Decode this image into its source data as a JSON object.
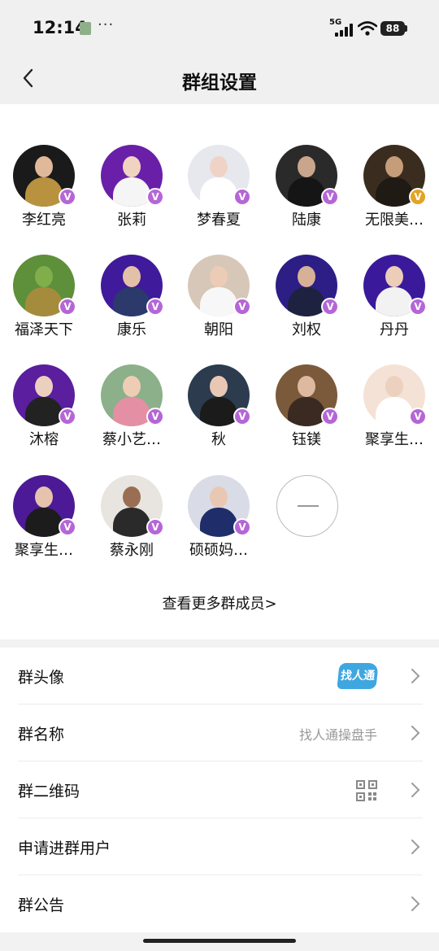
{
  "status_bar": {
    "time": "12:14",
    "dots": "···",
    "network": "5G",
    "battery": "88"
  },
  "header": {
    "title": "群组设置"
  },
  "members": [
    {
      "name": "李红亮",
      "bg": "#1a1a1a",
      "body": "#b8923e",
      "head": "#e0b89a",
      "badge": "#b566d6"
    },
    {
      "name": "张莉",
      "bg": "#6a1fa8",
      "body": "#f5f5f5",
      "head": "#f0d3c0",
      "badge": "#b566d6"
    },
    {
      "name": "梦春夏",
      "bg": "#e6e8ee",
      "body": "#ffffff",
      "head": "#efd3c6",
      "badge": "#b566d6"
    },
    {
      "name": "陆康",
      "bg": "#2a2a2a",
      "body": "#151515",
      "head": "#c9a58b",
      "badge": "#b566d6"
    },
    {
      "name": "无限美…",
      "bg": "#3a2d1f",
      "body": "#1f1a14",
      "head": "#c59d7a",
      "badge": "#e3a326"
    },
    {
      "name": "福泽天下",
      "bg": "#5e8f3a",
      "body": "#a58c3c",
      "head": "#7fae4a",
      "badge": "#b566d6"
    },
    {
      "name": "康乐",
      "bg": "#3f1a9a",
      "body": "#2b3a6a",
      "head": "#e3c1a8",
      "badge": "#b566d6"
    },
    {
      "name": "朝阳",
      "bg": "#d7c7b8",
      "body": "#f7f7f7",
      "head": "#ecccb6",
      "badge": "#b566d6"
    },
    {
      "name": "刘权",
      "bg": "#2d1e86",
      "body": "#1d2240",
      "head": "#d6b196",
      "badge": "#b566d6"
    },
    {
      "name": "丹丹",
      "bg": "#3a1a9a",
      "body": "#f2f2f2",
      "head": "#eccdb8",
      "badge": "#b566d6"
    },
    {
      "name": "沐榕",
      "bg": "#5a1e9e",
      "body": "#222222",
      "head": "#ecd0bf",
      "badge": "#b566d6"
    },
    {
      "name": "蔡小艺…",
      "bg": "#8bb08a",
      "body": "#e58fa4",
      "head": "#eecdb5",
      "badge": "#b566d6"
    },
    {
      "name": "秋",
      "bg": "#2c3b4e",
      "body": "#1b1b1b",
      "head": "#e8c8b4",
      "badge": "#b566d6"
    },
    {
      "name": "钰镁",
      "bg": "#7a5a3a",
      "body": "#3a2a22",
      "head": "#ddb9a0",
      "badge": "#b566d6"
    },
    {
      "name": "聚享生…",
      "bg": "#f4e2d6",
      "body": "#ffffff",
      "head": "#edd1bf",
      "badge": "#b566d6"
    },
    {
      "name": "聚享生…",
      "bg": "#4c1a96",
      "body": "#1c1c1c",
      "head": "#e6c3ad",
      "badge": "#b566d6"
    },
    {
      "name": "蔡永刚",
      "bg": "#e8e4e0",
      "body": "#2a2a2a",
      "head": "#9a6e52",
      "badge": "#b566d6"
    },
    {
      "name": "硕硕妈…",
      "bg": "#d9dce6",
      "body": "#1f2e6a",
      "head": "#e9c8b3",
      "badge": "#b566d6"
    }
  ],
  "badge_letter": "V",
  "view_more_label": "查看更多群成员>",
  "settings": {
    "avatar": {
      "label": "群头像",
      "logo_text": "找人通"
    },
    "name": {
      "label": "群名称",
      "value": "找人通操盘手"
    },
    "qr": {
      "label": "群二维码"
    },
    "requests": {
      "label": "申请进群用户"
    },
    "notice": {
      "label": "群公告"
    }
  },
  "colors": {
    "accent_blue": "#3fa7e0",
    "badge_purple": "#b566d6",
    "badge_gold": "#e3a326"
  }
}
